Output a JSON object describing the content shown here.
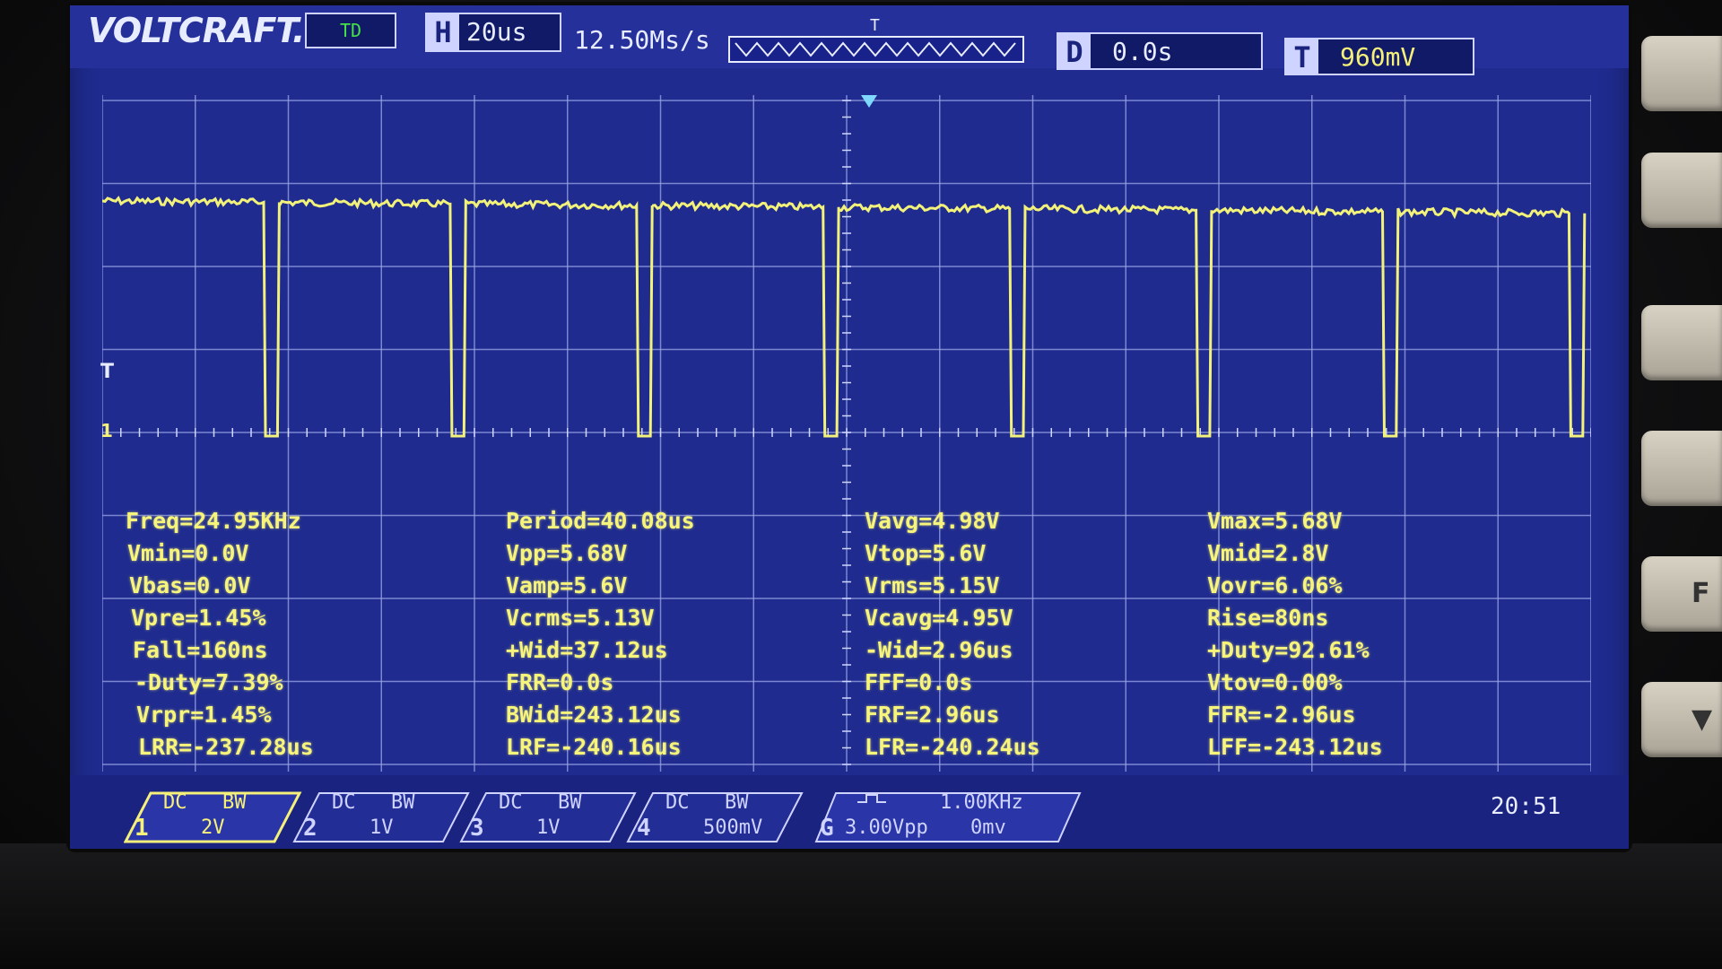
{
  "brand": "VOLTCRAFT.",
  "top": {
    "trigger_status": "TD",
    "timebase_key": "H",
    "timebase": "20us",
    "sample_rate": "12.50Ms/s",
    "memory_marker": "T",
    "delay_key": "D",
    "delay": "0.0s",
    "trigger_key": "T",
    "trigger_level": "960mV"
  },
  "side_markers": {
    "trigger_marker": "T",
    "ch1_marker": "1"
  },
  "measurements": {
    "col1": [
      "Freq=24.95KHz",
      "Vmin=0.0V",
      "Vbas=0.0V",
      "Vpre=1.45%",
      "Fall=160ns",
      "-Duty=7.39%",
      "Vrpr=1.45%",
      "LRR=-237.28us"
    ],
    "col2": [
      "Period=40.08us",
      "Vpp=5.68V",
      "Vamp=5.6V",
      "Vcrms=5.13V",
      "+Wid=37.12us",
      "FRR=0.0s",
      "BWid=243.12us",
      "LRF=-240.16us"
    ],
    "col3": [
      "Vavg=4.98V",
      "Vtop=5.6V",
      "Vrms=5.15V",
      "Vcavg=4.95V",
      "-Wid=2.96us",
      "FFF=0.0s",
      "FRF=2.96us",
      "LFR=-240.24us"
    ],
    "col4": [
      "Vmax=5.68V",
      "Vmid=2.8V",
      "Vovr=6.06%",
      "Rise=80ns",
      "+Duty=92.61%",
      "Vtov=0.00%",
      "FFR=-2.96us",
      "LFF=-243.12us"
    ]
  },
  "channels": [
    {
      "num": "1",
      "coupling": "DC",
      "bw": "BW",
      "scale": "2V",
      "color": "#f5f07a"
    },
    {
      "num": "2",
      "coupling": "DC",
      "bw": "BW",
      "scale": "1V",
      "color": "#cfd3ff"
    },
    {
      "num": "3",
      "coupling": "DC",
      "bw": "BW",
      "scale": "1V",
      "color": "#cfd3ff"
    },
    {
      "num": "4",
      "coupling": "DC",
      "bw": "BW",
      "scale": "500mV",
      "color": "#cfd3ff"
    }
  ],
  "generator": {
    "key": "G",
    "freq": "1.00KHz",
    "amplitude": "3.00Vpp",
    "offset": "0mv"
  },
  "clock": "20:51",
  "side_buttons": [
    "",
    "",
    "",
    "",
    "F",
    "▼"
  ],
  "waveform": {
    "color": "#f2f27a",
    "period_us": 40.08,
    "low_width_us": 2.96,
    "vmax_v": 5.68,
    "vmin_v": 0.0
  }
}
